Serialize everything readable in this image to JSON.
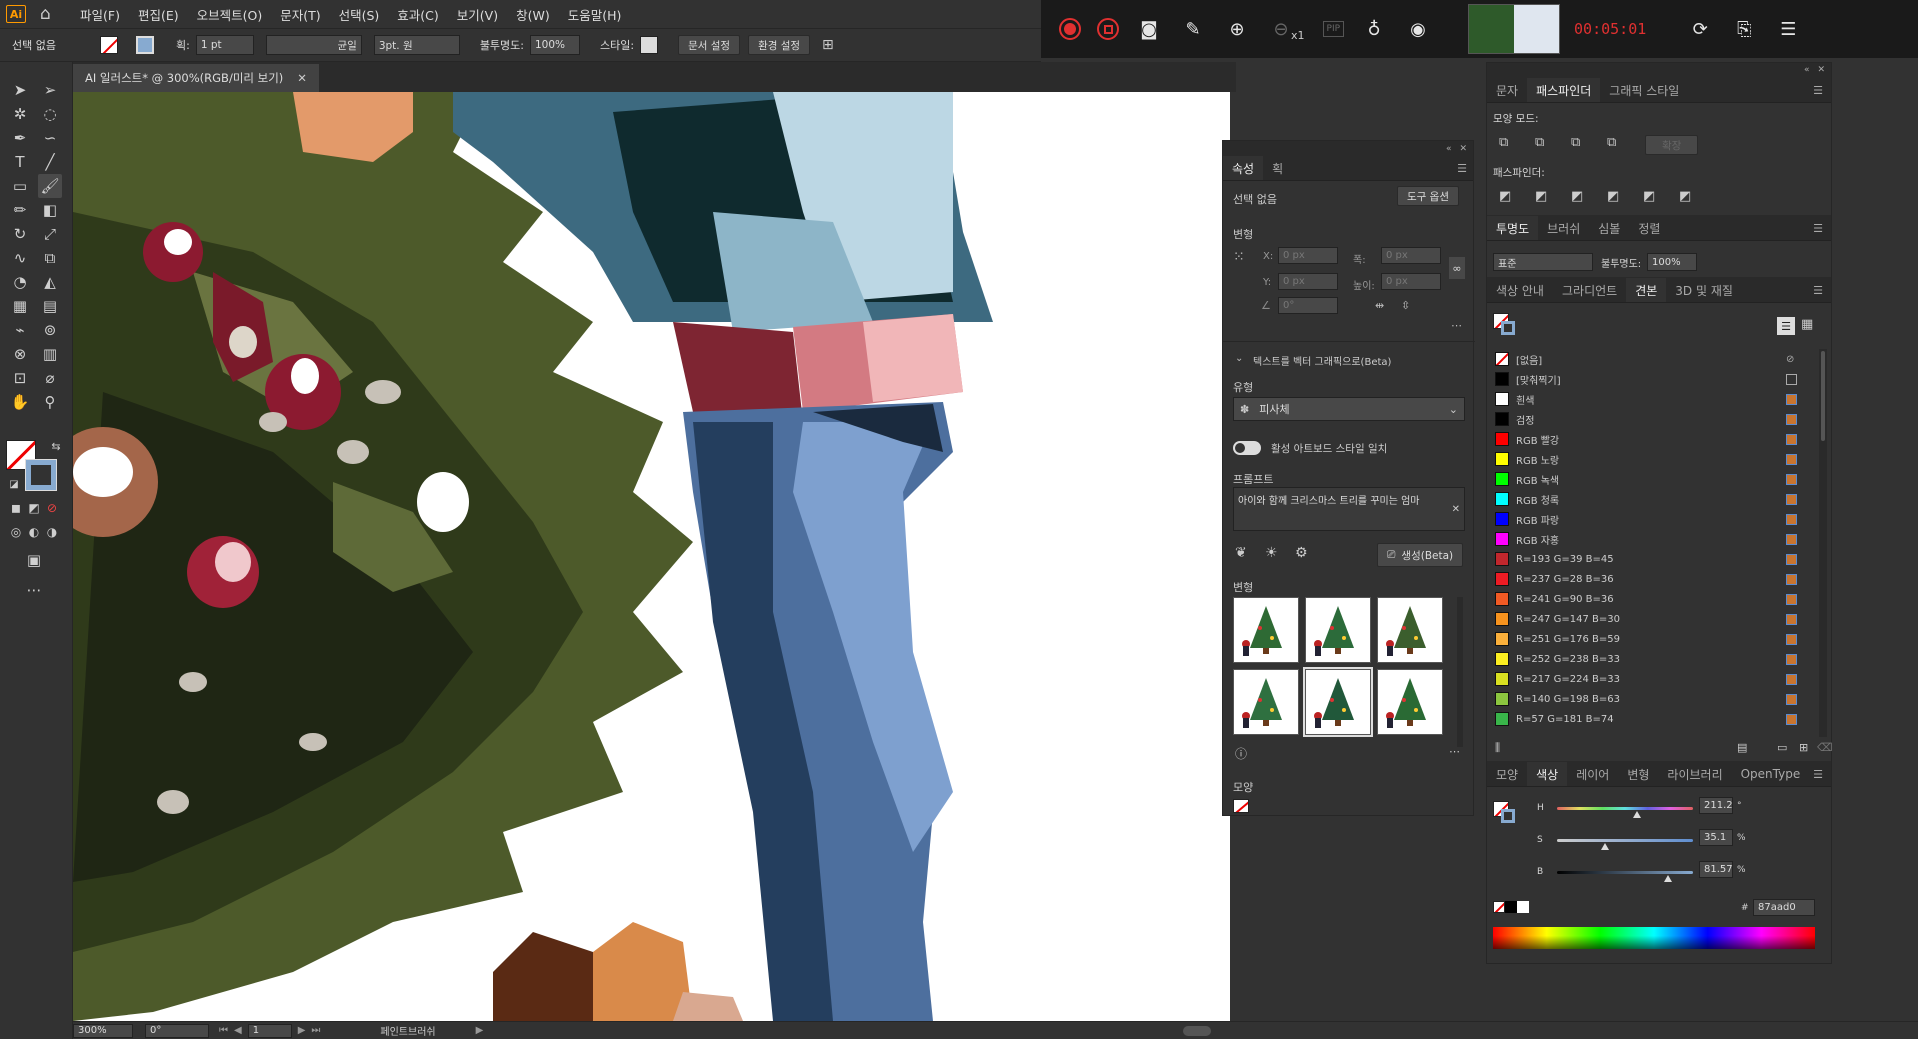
{
  "app": {
    "logo": "Ai"
  },
  "menu": [
    "파일(F)",
    "편집(E)",
    "오브젝트(O)",
    "문자(T)",
    "선택(S)",
    "효과(C)",
    "보기(V)",
    "창(W)",
    "도움말(H)"
  ],
  "recorder": {
    "time": "00:05:01",
    "zoom_label": "x1",
    "pip_label": "PIP"
  },
  "control_bar": {
    "selection": "선택 없음",
    "stroke_label": "획:",
    "stroke_weight": "1 pt",
    "stroke_profile": "균일",
    "brush": "3pt. 원",
    "opacity_label": "불투명도:",
    "opacity": "100%",
    "style_label": "스타일:",
    "doc_setup": "문서 설정",
    "preferences": "환경 설정"
  },
  "document_tab": {
    "title": "AI 일러스트* @ 300%(RGB/미리 보기)"
  },
  "status": {
    "zoom": "300%",
    "rotation": "0°",
    "artboard": "1",
    "tool": "페인트브러쉬"
  },
  "properties_panel": {
    "tabs": [
      "속성",
      "획"
    ],
    "selection": "선택 없음",
    "tool_options": "도구 옵션",
    "transform_label": "변형",
    "x_label": "X:",
    "x_value": "0 px",
    "y_label": "Y:",
    "y_value": "0 px",
    "w_label": "폭:",
    "w_value": "0 px",
    "h_label": "높이:",
    "h_value": "0 px",
    "angle_value": "0°",
    "text_to_vector": "텍스트를 벡터 그래픽으로(Beta)",
    "type_label": "유형",
    "type_value": "피사체",
    "match_style": "활성 아트보드 스타일 일치",
    "prompt_label": "프롬프트",
    "prompt_value": "아이와 함께 크리스마스 트리를 꾸미는 엄마",
    "generate": "생성(Beta)",
    "variations_label": "변형",
    "appearance_label": "모양"
  },
  "pathfinder_panel": {
    "tabs": [
      "문자",
      "패스파인더",
      "그래픽 스타일"
    ],
    "shape_modes": "모양 모드:",
    "expand": "확장",
    "pathfinders": "패스파인더:"
  },
  "transparency_panel": {
    "tabs": [
      "투명도",
      "브러쉬",
      "심볼",
      "정렬"
    ],
    "blend_mode": "표준",
    "opacity_label": "불투명도:",
    "opacity": "100%"
  },
  "swatches_panel": {
    "tabs": [
      "색상 안내",
      "그라디언트",
      "견본",
      "3D 및 재질"
    ],
    "swatches": [
      {
        "name": "[없음]",
        "color": "none"
      },
      {
        "name": "[맞춰찍기]",
        "color": "#000000"
      },
      {
        "name": "흰색",
        "color": "#ffffff"
      },
      {
        "name": "검정",
        "color": "#000000"
      },
      {
        "name": "RGB 빨강",
        "color": "#ff0000"
      },
      {
        "name": "RGB 노랑",
        "color": "#ffff00"
      },
      {
        "name": "RGB 녹색",
        "color": "#00ff00"
      },
      {
        "name": "RGB 청록",
        "color": "#00ffff"
      },
      {
        "name": "RGB 파랑",
        "color": "#0000ff"
      },
      {
        "name": "RGB 자홍",
        "color": "#ff00ff"
      },
      {
        "name": "R=193 G=39 B=45",
        "color": "#c1272d"
      },
      {
        "name": "R=237 G=28 B=36",
        "color": "#ed1c24"
      },
      {
        "name": "R=241 G=90 B=36",
        "color": "#f15a24"
      },
      {
        "name": "R=247 G=147 B=30",
        "color": "#f7931e"
      },
      {
        "name": "R=251 G=176 B=59",
        "color": "#fbb03b"
      },
      {
        "name": "R=252 G=238 B=33",
        "color": "#fcee21"
      },
      {
        "name": "R=217 G=224 B=33",
        "color": "#d9e021"
      },
      {
        "name": "R=140 G=198 B=63",
        "color": "#8cc63f"
      },
      {
        "name": "R=57 G=181 B=74",
        "color": "#39b54a"
      }
    ]
  },
  "color_panel": {
    "tabs": [
      "모양",
      "색상",
      "레이어",
      "변형",
      "라이브러리",
      "OpenType"
    ],
    "h_label": "H",
    "h_value": "211.2",
    "h_unit": "°",
    "h_level": 0.59,
    "s_label": "S",
    "s_value": "35.1",
    "s_unit": "%",
    "s_level": 0.351,
    "b_label": "B",
    "b_value": "81.57",
    "b_unit": "%",
    "b_level": 0.816,
    "hex_prefix": "#",
    "hex": "87aad0"
  },
  "colors": {
    "accent": "#87aad0",
    "record": "#e03030"
  }
}
